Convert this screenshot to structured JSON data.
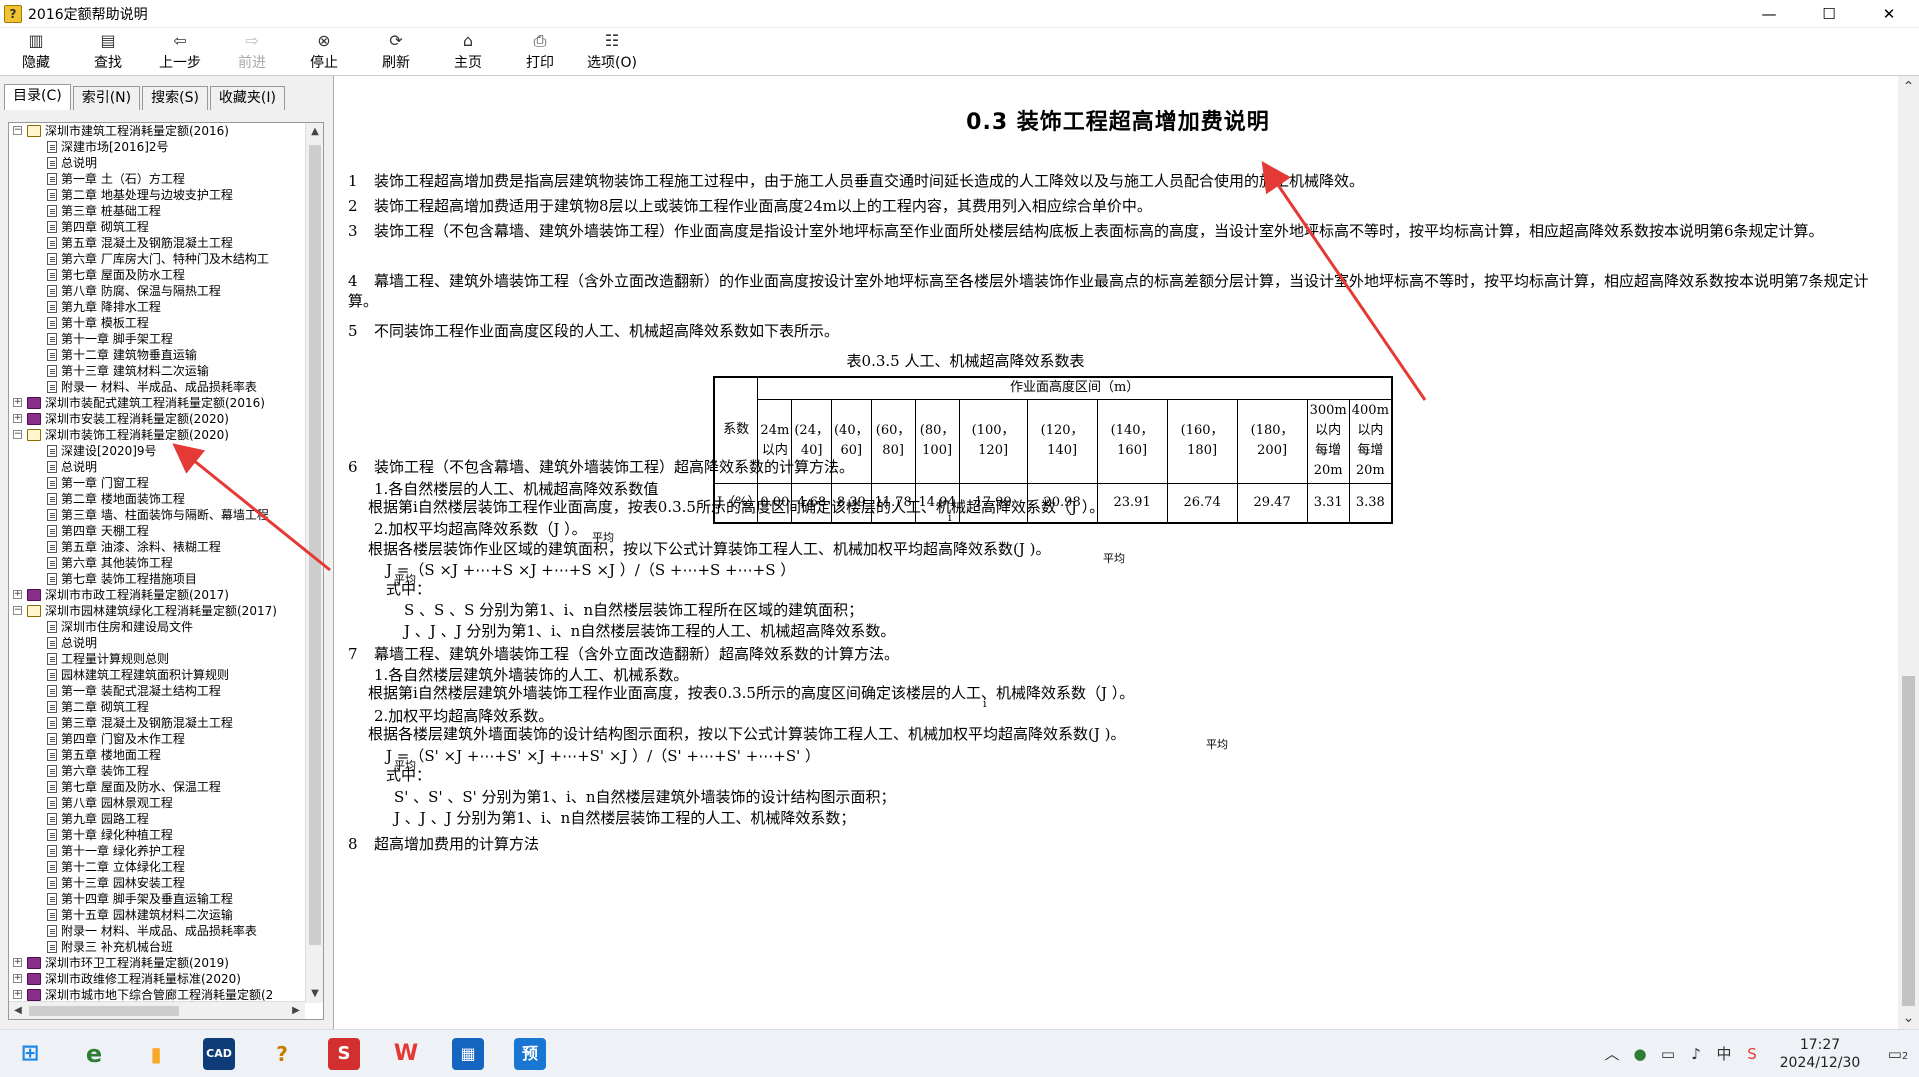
{
  "window": {
    "title": "2016定额帮助说明",
    "minimize": "—",
    "maximize": "☐",
    "close": "✕"
  },
  "toolbar": {
    "hide": "隐藏",
    "find": "查找",
    "back": "上一步",
    "forward": "前进",
    "stop": "停止",
    "refresh": "刷新",
    "home": "主页",
    "print": "打印",
    "options": "选项(O)"
  },
  "tabs": {
    "contents": "目录(C)",
    "index": "索引(N)",
    "search": "搜索(S)",
    "favorites": "收藏夹(I)"
  },
  "tree": [
    {
      "level": 0,
      "type": "book-open",
      "label": "深圳市建筑工程消耗量定额(2016)"
    },
    {
      "level": 1,
      "type": "page",
      "label": "深建市场[2016]2号"
    },
    {
      "level": 1,
      "type": "page",
      "label": "总说明"
    },
    {
      "level": 1,
      "type": "page",
      "label": "第一章  土（石）方工程"
    },
    {
      "level": 1,
      "type": "page",
      "label": "第二章  地基处理与边坡支护工程"
    },
    {
      "level": 1,
      "type": "page",
      "label": "第三章  桩基础工程"
    },
    {
      "level": 1,
      "type": "page",
      "label": "第四章  砌筑工程"
    },
    {
      "level": 1,
      "type": "page",
      "label": "第五章  混凝土及钢筋混凝土工程"
    },
    {
      "level": 1,
      "type": "page",
      "label": "第六章  厂库房大门、特种门及木结构工"
    },
    {
      "level": 1,
      "type": "page",
      "label": "第七章  屋面及防水工程"
    },
    {
      "level": 1,
      "type": "page",
      "label": "第八章  防腐、保温与隔热工程"
    },
    {
      "level": 1,
      "type": "page",
      "label": "第九章  降排水工程"
    },
    {
      "level": 1,
      "type": "page",
      "label": "第十章  模板工程"
    },
    {
      "level": 1,
      "type": "page",
      "label": "第十一章  脚手架工程"
    },
    {
      "level": 1,
      "type": "page",
      "label": "第十二章  建筑物垂直运输"
    },
    {
      "level": 1,
      "type": "page",
      "label": "第十三章  建筑材料二次运输"
    },
    {
      "level": 1,
      "type": "page",
      "label": "附录一  材料、半成品、成品损耗率表"
    },
    {
      "level": 0,
      "type": "book-closed",
      "label": "深圳市装配式建筑工程消耗量定额(2016)"
    },
    {
      "level": 0,
      "type": "book-closed",
      "label": "深圳市安装工程消耗量定额(2020)"
    },
    {
      "level": 0,
      "type": "book-open",
      "label": "深圳市装饰工程消耗量定额(2020)"
    },
    {
      "level": 1,
      "type": "page",
      "label": "深建设[2020]9号"
    },
    {
      "level": 1,
      "type": "page",
      "label": "总说明"
    },
    {
      "level": 1,
      "type": "page",
      "label": "第一章  门窗工程"
    },
    {
      "level": 1,
      "type": "page",
      "label": "第二章  楼地面装饰工程"
    },
    {
      "level": 1,
      "type": "page",
      "label": "第三章  墙、柱面装饰与隔断、幕墙工程"
    },
    {
      "level": 1,
      "type": "page",
      "label": "第四章  天棚工程"
    },
    {
      "level": 1,
      "type": "page",
      "label": "第五章  油漆、涂料、裱糊工程"
    },
    {
      "level": 1,
      "type": "page",
      "label": "第六章  其他装饰工程"
    },
    {
      "level": 1,
      "type": "page",
      "label": "第七章  装饰工程措施项目"
    },
    {
      "level": 0,
      "type": "book-closed",
      "label": "深圳市市政工程消耗量定额(2017)"
    },
    {
      "level": 0,
      "type": "book-open",
      "label": "深圳市园林建筑绿化工程消耗量定额(2017)"
    },
    {
      "level": 1,
      "type": "page",
      "label": "深圳市住房和建设局文件"
    },
    {
      "level": 1,
      "type": "page",
      "label": "总说明"
    },
    {
      "level": 1,
      "type": "page",
      "label": "工程量计算规则总则"
    },
    {
      "level": 1,
      "type": "page",
      "label": "园林建筑工程建筑面积计算规则"
    },
    {
      "level": 1,
      "type": "page",
      "label": "第一章  装配式混凝土结构工程"
    },
    {
      "level": 1,
      "type": "page",
      "label": "第二章  砌筑工程"
    },
    {
      "level": 1,
      "type": "page",
      "label": "第三章  混凝土及钢筋混凝土工程"
    },
    {
      "level": 1,
      "type": "page",
      "label": "第四章  门窗及木作工程"
    },
    {
      "level": 1,
      "type": "page",
      "label": "第五章  楼地面工程"
    },
    {
      "level": 1,
      "type": "page",
      "label": "第六章  装饰工程"
    },
    {
      "level": 1,
      "type": "page",
      "label": "第七章  屋面及防水、保温工程"
    },
    {
      "level": 1,
      "type": "page",
      "label": "第八章  园林景观工程"
    },
    {
      "level": 1,
      "type": "page",
      "label": "第九章  园路工程"
    },
    {
      "level": 1,
      "type": "page",
      "label": "第十章  绿化种植工程"
    },
    {
      "level": 1,
      "type": "page",
      "label": "第十一章  绿化养护工程"
    },
    {
      "level": 1,
      "type": "page",
      "label": "第十二章  立体绿化工程"
    },
    {
      "level": 1,
      "type": "page",
      "label": "第十三章  园林安装工程"
    },
    {
      "level": 1,
      "type": "page",
      "label": "第十四章  脚手架及垂直运输工程"
    },
    {
      "level": 1,
      "type": "page",
      "label": "第十五章  园林建筑材料二次运输"
    },
    {
      "level": 1,
      "type": "page",
      "label": "附录一  材料、半成品、成品损耗率表"
    },
    {
      "level": 1,
      "type": "page",
      "label": "附录三  补充机械台班"
    },
    {
      "level": 0,
      "type": "book-closed",
      "label": "深圳市环卫工程消耗量定额(2019)"
    },
    {
      "level": 0,
      "type": "book-closed",
      "label": "深圳市政维修工程消耗量标准(2020)"
    },
    {
      "level": 0,
      "type": "book-closed",
      "label": "深圳市城市地下综合管廊工程消耗量定额(2"
    }
  ],
  "doc": {
    "title": "0.3  装饰工程超高增加费说明",
    "p1n": "1",
    "p1": "装饰工程超高增加费是指高层建筑物装饰工程施工过程中，由于施工人员垂直交通时间延长造成的人工降效以及与施工人员配合使用的施工机械降效。",
    "p2n": "2",
    "p2": "装饰工程超高增加费适用于建筑物8层以上或装饰工程作业面高度24m以上的工程内容，其费用列入相应综合单价中。",
    "p3n": "3",
    "p3": "装饰工程（不包含幕墙、建筑外墙装饰工程）作业面高度是指设计室外地坪标高至作业面所处楼层结构底板上表面标高的高度，当设计室外地坪标高不等时，按平均标高计算，相应超高降效系数按本说明第6条规定计算。",
    "p4n": "4",
    "p4": "幕墙工程、建筑外墙装饰工程（含外立面改造翻新）的作业面高度按设计室外地坪标高至各楼层外墙装饰作业最高点的标高差额分层计算，当设计室外地坪标高不等时，按平均标高计算，相应超高降效系数按本说明第7条规定计算。",
    "p5n": "5",
    "p5": "不同装饰工程作业面高度区段的人工、机械超高降效系数如下表所示。",
    "table_caption": "表0.3.5 人工、机械超高降效系数表",
    "table": {
      "coef_header": "系数",
      "range_header": "作业面高度区间（m）",
      "columns": [
        "24m以内",
        "(24，40]",
        "(40，60]",
        "(60，80]",
        "(80，100]",
        "(100，120]",
        "(120，140]",
        "(140，160]",
        "(160，180]",
        "(180，200]",
        "300m以内每增20m",
        "400m以内每增20m"
      ],
      "row_label": "J（%）",
      "values": [
        "0.00",
        "4.68",
        "8.39",
        "11.78",
        "14.94",
        "17.99",
        "20.98",
        "23.91",
        "26.74",
        "29.47",
        "3.31",
        "3.38"
      ]
    },
    "p6n": "6",
    "p6": "装饰工程（不包含幕墙、建筑外墙装饰工程）超高降效系数的计算方法。",
    "p6_1": "1.各自然楼层的人工、机械超高降效系数值",
    "p6_1a": "根据第i自然楼层装饰工程作业面高度，按表0.3.5所示的高度区间确定该楼层的人工、机械超高降效系数（J  ）。",
    "p6_2": "2.加权平均超高降效系数（J      ）。",
    "p6_2a": "根据各楼层装饰作业区域的建筑面积，按以下公式计算装饰工程人工、机械加权平均超高降效系数(J       )。",
    "f6": "J      =（S  ×J  +⋯+S  ×J  +⋯+S  ×J  ）/（S  +⋯+S  +⋯+S  ）",
    "f6_where": "式中：",
    "f6_s": "S  、S  、S   分别为第1、i、n自然楼层装饰工程所在区域的建筑面积；",
    "f6_j": "J  、J  、J   分别为第1、i、n自然楼层装饰工程的人工、机械超高降效系数。",
    "p7n": "7",
    "p7": "幕墙工程、建筑外墙装饰工程（含外立面改造翻新）超高降效系数的计算方法。",
    "p7_1": "1.各自然楼层建筑外墙装饰的人工、机械系数。",
    "p7_1a": "根据第i自然楼层建筑外墙装饰工程作业面高度，按表0.3.5所示的高度区间确定该楼层的人工、机械降效系数（J  ）。",
    "p7_2": "2.加权平均超高降效系数。",
    "p7_2a": "根据各楼层建筑外墙面装饰的设计结构图示面积，按以下公式计算装饰工程人工、机械加权平均超高降效系数(J       )。",
    "f7": "J      =（S'  ×J  +⋯+S'  ×J  +⋯+S'  ×J  ）/（S'  +⋯+S'  +⋯+S'  ）",
    "f7_where": "式中：",
    "f7_s": "S'  、S'  、S'   分别为第1、i、n自然楼层建筑外墙装饰的设计结构图示面积；",
    "f7_j": "J  、J  、J   分别为第1、i、n自然楼层装饰工程的人工、机械降效系数；",
    "p8n": "8",
    "p8": "超高增加费用的计算方法",
    "sub_pingjun": "平均",
    "sub_i": "i",
    "sub_1": "1",
    "sub_n": "n"
  },
  "taskbar": {
    "time": "17:27",
    "date": "2024/12/30",
    "ime": "中",
    "notif_count": "2",
    "wps_label": "W",
    "ie_label": "e",
    "cad_label": "CAD",
    "pre_label": "预"
  }
}
